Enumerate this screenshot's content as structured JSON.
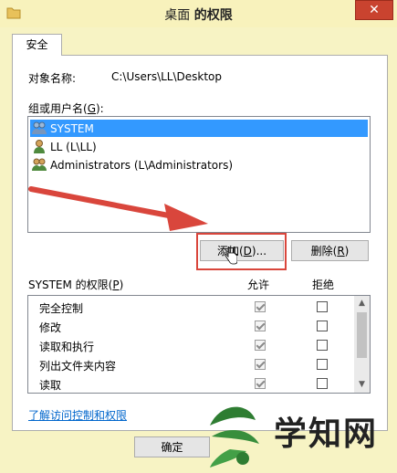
{
  "window": {
    "title_plain": "桌面 ",
    "title_bold": "的权限",
    "close_label": "✕"
  },
  "tabs": [
    {
      "label": "安全"
    }
  ],
  "object": {
    "label": "对象名称:",
    "value": "C:\\Users\\LL\\Desktop"
  },
  "groups": {
    "label_pre": "组或用户名(",
    "label_key": "G",
    "label_post": "):",
    "items": [
      {
        "label": "SYSTEM",
        "selected": true
      },
      {
        "label": "LL (L\\LL)",
        "selected": false
      },
      {
        "label": "Administrators (L\\Administrators)",
        "selected": false
      }
    ]
  },
  "buttons": {
    "add_pre": "添加(",
    "add_key": "D",
    "add_post": ")...",
    "remove_pre": "删除(",
    "remove_key": "R",
    "remove_post": ")",
    "ok": "确定"
  },
  "permissions": {
    "header_pre": "SYSTEM 的权限(",
    "header_key": "P",
    "header_post": ")",
    "allow_label": "允许",
    "deny_label": "拒绝",
    "rows": [
      {
        "name": "完全控制",
        "allow": true,
        "deny": false
      },
      {
        "name": "修改",
        "allow": true,
        "deny": false
      },
      {
        "name": "读取和执行",
        "allow": true,
        "deny": false
      },
      {
        "name": "列出文件夹内容",
        "allow": true,
        "deny": false
      },
      {
        "name": "读取",
        "allow": true,
        "deny": false
      }
    ]
  },
  "link": "了解访问控制和权限",
  "watermark": {
    "text": "学知网"
  },
  "colors": {
    "selection": "#3399ff",
    "highlight": "#d9463c",
    "close": "#c9432f",
    "link": "#0066cc"
  }
}
